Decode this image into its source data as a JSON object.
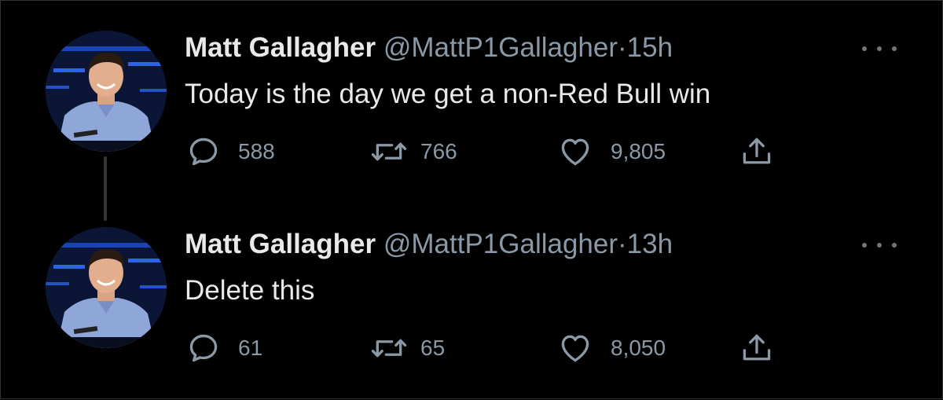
{
  "tweets": [
    {
      "name": "Matt Gallagher",
      "handle": "@MattP1Gallagher",
      "separator": "·",
      "time": "15h",
      "text": "Today is the day we get a non-Red Bull win",
      "replies": "588",
      "retweets": "766",
      "likes": "9,805"
    },
    {
      "name": "Matt Gallagher",
      "handle": "@MattP1Gallagher",
      "separator": "·",
      "time": "13h",
      "text": "Delete this",
      "replies": "61",
      "retweets": "65",
      "likes": "8,050"
    }
  ],
  "icons": {
    "reply": "reply-icon",
    "retweet": "retweet-icon",
    "like": "heart-icon",
    "share": "share-icon",
    "more": "more-icon"
  },
  "colors": {
    "background": "#000000",
    "primary_text": "#e7e9ea",
    "secondary_text": "#8b98a5",
    "icon": "#8b98a5",
    "thread_line": "#333639"
  }
}
